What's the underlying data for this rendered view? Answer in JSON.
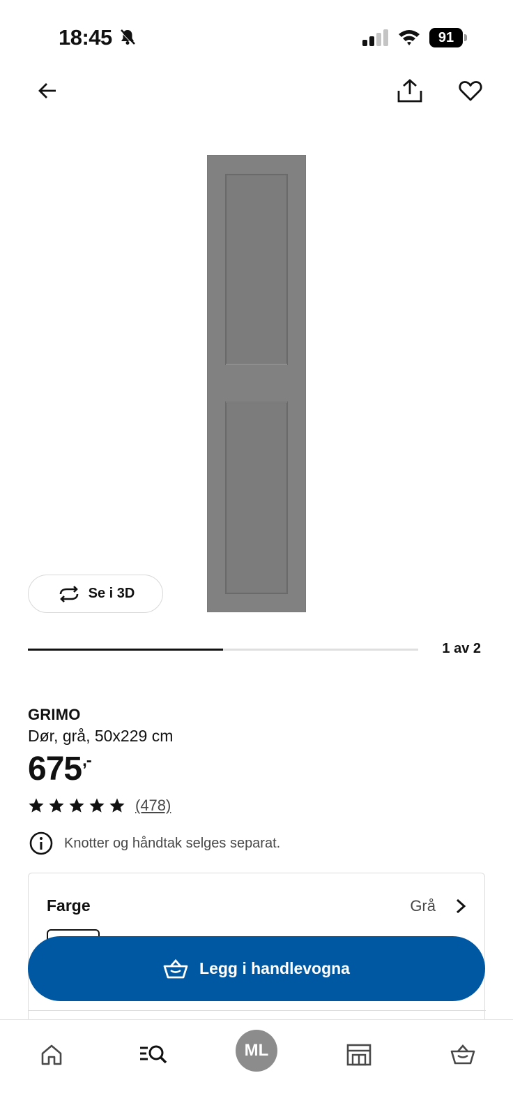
{
  "status_bar": {
    "time": "18:45",
    "battery": "91"
  },
  "product": {
    "name": "GRIMO",
    "description": "Dør, grå, 50x229 cm",
    "price": "675",
    "price_suffix": ",-",
    "rating_stars": 5,
    "rating_count": "(478)",
    "info_note": "Knotter og håndtak selges separat.",
    "image_color": "#7f7f7f"
  },
  "gallery": {
    "view_3d_label": "Se i 3D",
    "page_indicator": "1 av 2",
    "progress_fraction": 0.5
  },
  "color_option": {
    "label": "Farge",
    "value": "Grå"
  },
  "cart_button": {
    "label": "Legg i handlevogna",
    "color": "#0058a3"
  },
  "tab_bar": {
    "profile_initials": "ML",
    "icons": [
      "home-icon",
      "search-icon",
      "profile-avatar",
      "store-icon",
      "cart-icon"
    ]
  }
}
